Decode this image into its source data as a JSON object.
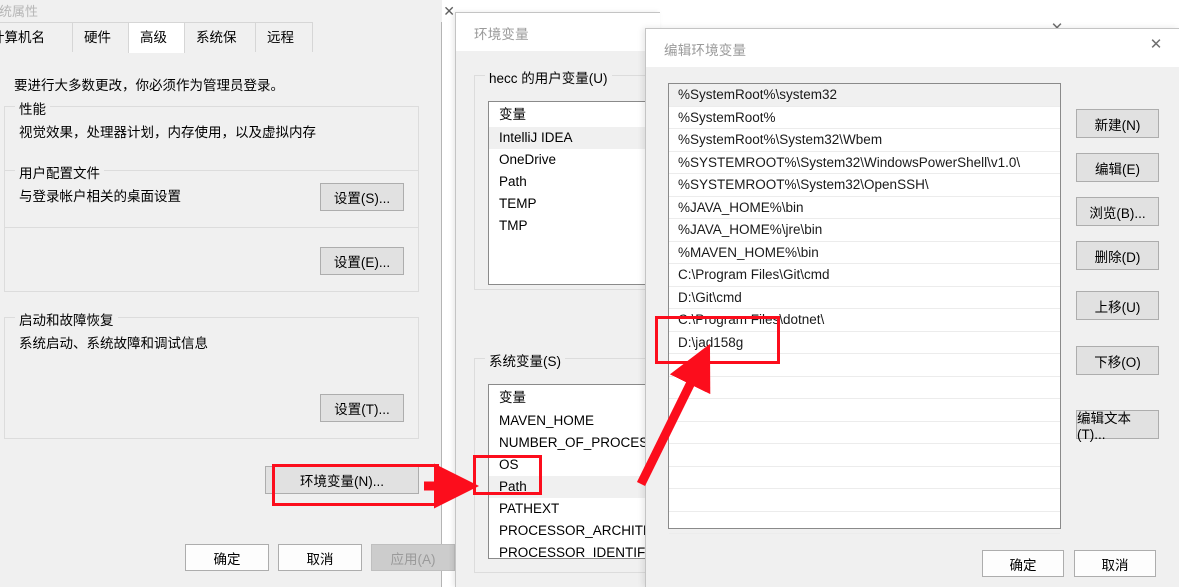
{
  "system_properties": {
    "window_title": "系统属性",
    "tabs": [
      {
        "label": "计算机名",
        "active": false
      },
      {
        "label": "硬件",
        "active": false
      },
      {
        "label": "高级",
        "active": true
      },
      {
        "label": "系统保护",
        "active": false
      },
      {
        "label": "远程",
        "active": false
      }
    ],
    "hint": "要进行大多数更改，你必须作为管理员登录。",
    "groups": [
      {
        "legend": "性能",
        "desc": "视觉效果，处理器计划，内存使用，以及虚拟内存",
        "button": "设置(S)..."
      },
      {
        "legend": "用户配置文件",
        "desc": "与登录帐户相关的桌面设置",
        "button": "设置(E)..."
      },
      {
        "legend": "启动和故障恢复",
        "desc": "系统启动、系统故障和调试信息",
        "button": "设置(T)..."
      }
    ],
    "env_button": "环境变量(N)...",
    "footer": {
      "ok": "确定",
      "cancel": "取消",
      "apply": "应用(A)"
    }
  },
  "environment_variables": {
    "window_title": "环境变量",
    "user_group_legend": "hecc 的用户变量(U)",
    "user_column_header": "变量",
    "user_variables": [
      {
        "name": "IntelliJ IDEA",
        "selected": true
      },
      {
        "name": "OneDrive",
        "selected": false
      },
      {
        "name": "Path",
        "selected": false
      },
      {
        "name": "TEMP",
        "selected": false
      },
      {
        "name": "TMP",
        "selected": false
      }
    ],
    "system_group_legend": "系统变量(S)",
    "system_column_header": "变量",
    "system_variables": [
      {
        "name": "MAVEN_HOME",
        "selected": false
      },
      {
        "name": "NUMBER_OF_PROCESSORS",
        "selected": false
      },
      {
        "name": "OS",
        "selected": false
      },
      {
        "name": "Path",
        "selected": true
      },
      {
        "name": "PATHEXT",
        "selected": false
      },
      {
        "name": "PROCESSOR_ARCHITECT...",
        "selected": false
      },
      {
        "name": "PROCESSOR_IDENTIFIER",
        "selected": false
      }
    ]
  },
  "edit_environment_variable": {
    "window_title": "编辑环境变量",
    "close_icon": "close-icon",
    "path_entries": [
      {
        "value": "%SystemRoot%\\system32",
        "selected": true
      },
      {
        "value": "%SystemRoot%",
        "selected": false
      },
      {
        "value": "%SystemRoot%\\System32\\Wbem",
        "selected": false
      },
      {
        "value": "%SYSTEMROOT%\\System32\\WindowsPowerShell\\v1.0\\",
        "selected": false
      },
      {
        "value": "%SYSTEMROOT%\\System32\\OpenSSH\\",
        "selected": false
      },
      {
        "value": "%JAVA_HOME%\\bin",
        "selected": false
      },
      {
        "value": "%JAVA_HOME%\\jre\\bin",
        "selected": false
      },
      {
        "value": "%MAVEN_HOME%\\bin",
        "selected": false
      },
      {
        "value": "C:\\Program Files\\Git\\cmd",
        "selected": false
      },
      {
        "value": "D:\\Git\\cmd",
        "selected": false
      },
      {
        "value": "C:\\Program Files\\dotnet\\",
        "selected": false
      },
      {
        "value": "D:\\jad158g",
        "selected": false
      },
      {
        "value": "",
        "selected": false
      },
      {
        "value": "",
        "selected": false
      },
      {
        "value": "",
        "selected": false
      },
      {
        "value": "",
        "selected": false
      },
      {
        "value": "",
        "selected": false
      },
      {
        "value": "",
        "selected": false
      },
      {
        "value": "",
        "selected": false
      },
      {
        "value": "",
        "selected": false
      }
    ],
    "side_buttons": [
      {
        "label": "新建(N)",
        "name": "new-button"
      },
      {
        "label": "编辑(E)",
        "name": "edit-button"
      },
      {
        "label": "浏览(B)...",
        "name": "browse-button"
      },
      {
        "label": "删除(D)",
        "name": "delete-button"
      },
      {
        "label": "上移(U)",
        "name": "move-up-button"
      },
      {
        "label": "下移(O)",
        "name": "move-down-button"
      },
      {
        "label": "编辑文本(T)...",
        "name": "edit-text-button"
      }
    ],
    "footer": {
      "ok": "确定",
      "cancel": "取消"
    }
  },
  "annotations": {
    "accent_color": "#fc0d1c",
    "highlight_targets": [
      "环境变量(N)...",
      "Path",
      "D:\\jad158g"
    ]
  }
}
